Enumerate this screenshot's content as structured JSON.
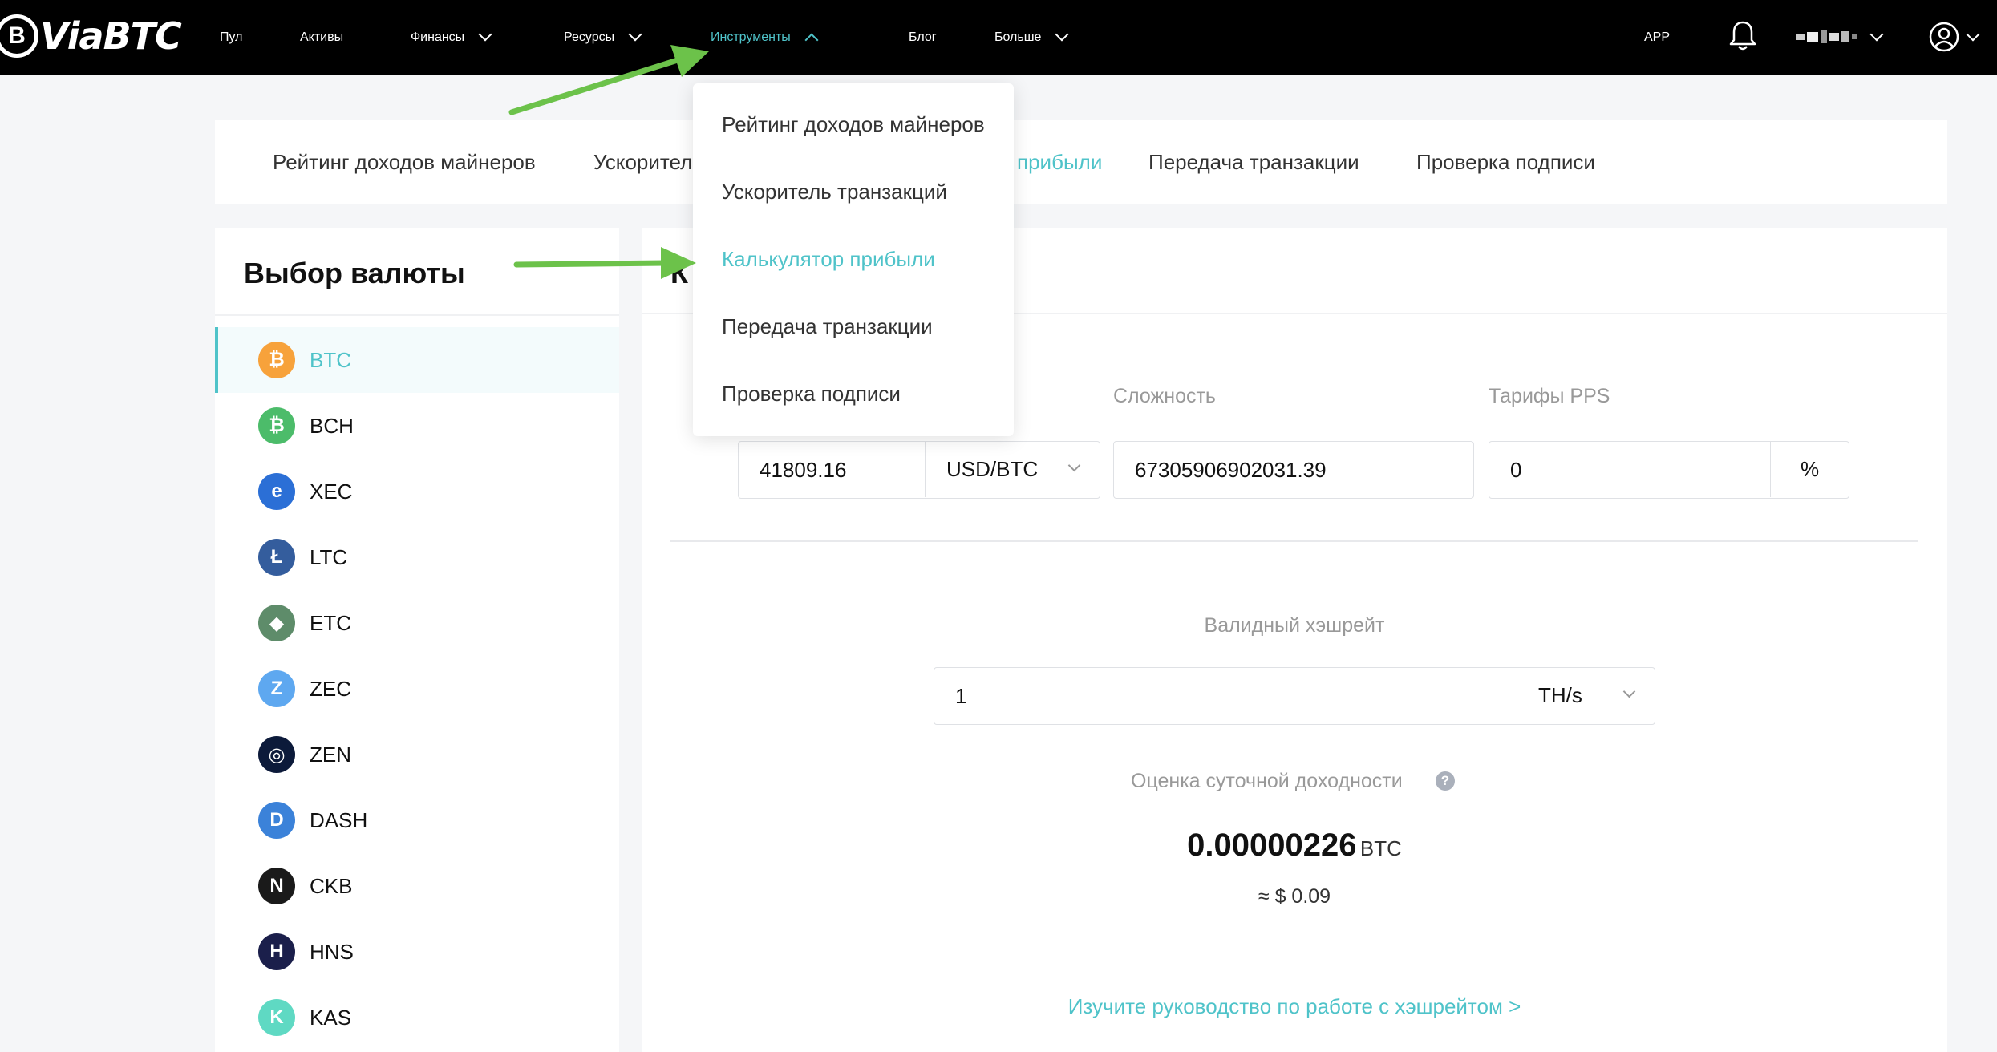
{
  "header": {
    "logo_text": "ViaBTC",
    "logo_mark": "B",
    "nav": [
      {
        "label": "Пул"
      },
      {
        "label": "Активы"
      },
      {
        "label": "Финансы"
      },
      {
        "label": "Ресурсы"
      },
      {
        "label": "Инструменты"
      },
      {
        "label": "Блог"
      },
      {
        "label": "Больше"
      }
    ],
    "app_label": "APP",
    "icons": {
      "notifications": "bell-icon",
      "profile": "user-circle-icon"
    }
  },
  "tools_tabs": [
    {
      "label": "Рейтинг доходов майнеров"
    },
    {
      "label": "Ускорител"
    },
    {
      "label": "прибыли"
    },
    {
      "label": "Передача транзакции"
    },
    {
      "label": "Проверка подписи"
    }
  ],
  "dropdown": {
    "items": [
      {
        "label": "Рейтинг доходов майнеров"
      },
      {
        "label": "Ускоритель транзакций"
      },
      {
        "label": "Калькулятор прибыли"
      },
      {
        "label": "Передача транзакции"
      },
      {
        "label": "Проверка подписи"
      }
    ]
  },
  "sidebar": {
    "title": "Выбор валюты",
    "coins": [
      {
        "symbol": "BTC",
        "icon": "bitcoin-icon",
        "color": "#f7a23b"
      },
      {
        "symbol": "BCH",
        "icon": "bitcoin-cash-icon",
        "color": "#4cbc6a"
      },
      {
        "symbol": "XEC",
        "icon": "ecash-icon",
        "color": "#2b6fd6"
      },
      {
        "symbol": "LTC",
        "icon": "litecoin-icon",
        "color": "#345d9d"
      },
      {
        "symbol": "ETC",
        "icon": "ethereum-classic-icon",
        "color": "#5e8c6a"
      },
      {
        "symbol": "ZEC",
        "icon": "zcash-icon",
        "color": "#5ea8f0"
      },
      {
        "symbol": "ZEN",
        "icon": "horizen-icon",
        "color": "#0c1a3a"
      },
      {
        "symbol": "DASH",
        "icon": "dash-icon",
        "color": "#3b82d9"
      },
      {
        "symbol": "CKB",
        "icon": "nervos-icon",
        "color": "#1a1a1a"
      },
      {
        "symbol": "HNS",
        "icon": "handshake-icon",
        "color": "#1b1f4b"
      },
      {
        "symbol": "KAS",
        "icon": "kaspa-icon",
        "color": "#5fd9c3"
      }
    ]
  },
  "calculator": {
    "title_fragment": "К",
    "difficulty_label": "Сложность",
    "pps_label": "Тарифы PPS",
    "price_value": "41809.16",
    "price_unit": "USD/BTC",
    "difficulty_value": "67305906902031.39",
    "pps_value": "0",
    "pps_unit": "%",
    "hashrate_label": "Валидный хэшрейт",
    "hashrate_value": "1",
    "hashrate_unit": "TH/s",
    "estimate_label": "Оценка суточной доходности",
    "estimate_value": "0.00000226",
    "estimate_unit": "BTC",
    "estimate_usd": "≈ $ 0.09",
    "guide_link": "Изучите руководство по работе с хэшрейтом >"
  },
  "colors": {
    "accent": "#4fc3c9",
    "annotation_arrow": "#6cc24a"
  }
}
